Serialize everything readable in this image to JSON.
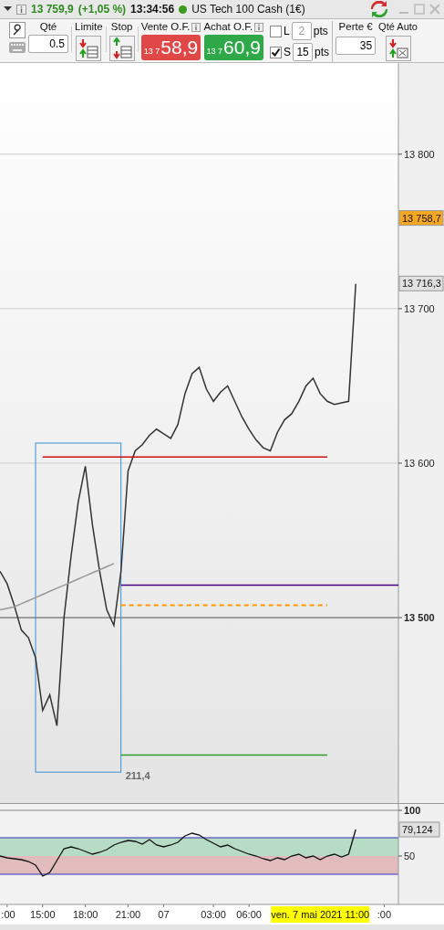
{
  "title_bar": {
    "price": "13 759,9",
    "change": "(+1,05 %)",
    "time": "13:34:56",
    "instrument": "US Tech 100 Cash (1€)"
  },
  "toolbar": {
    "qty": {
      "label": "Qté",
      "value": "0.5"
    },
    "limit": {
      "label": "Limite"
    },
    "stop": {
      "label": "Stop"
    },
    "sell": {
      "label": "Vente O.F.",
      "prefix": "13 7",
      "price": "58,9"
    },
    "buy": {
      "label": "Achat O.F.",
      "prefix": "13 7",
      "price": "60,9"
    },
    "offsets": [
      {
        "label": "L",
        "checked": false,
        "value": "2",
        "disabled": true,
        "unit": "pts"
      },
      {
        "label": "S",
        "checked": true,
        "value": "15",
        "disabled": false,
        "unit": "pts"
      }
    ],
    "loss": {
      "label": "Perte €",
      "value": "35"
    },
    "auto_qty": {
      "label": "Qté Auto"
    }
  },
  "price_chart": {
    "chart_data": {
      "type": "line",
      "grid": true,
      "ylim": [
        13380,
        13859
      ],
      "yticks": [
        {
          "value": 13500,
          "label": "13 500"
        },
        {
          "value": 13600,
          "label": "13 600"
        },
        {
          "value": 13700,
          "label": "13 700"
        },
        {
          "value": 13800,
          "label": "13 800"
        },
        {
          "value": 13758.7,
          "label": "13 758,7"
        },
        {
          "value": 13716.3,
          "label": "13 716,3"
        }
      ],
      "series": [
        {
          "color": "#333333",
          "values": [
            13530,
            13522,
            13508,
            13492,
            13487,
            13474,
            13440,
            13450,
            13430,
            13500,
            13540,
            13575,
            13598,
            13560,
            13530,
            13505,
            13495,
            13530,
            13595,
            13608,
            13612,
            13618,
            13622,
            13619,
            13616,
            13625,
            13645,
            13658,
            13662,
            13648,
            13640,
            13646,
            13650,
            13640,
            13630,
            13622,
            13615,
            13610,
            13608,
            13620,
            13628,
            13632,
            13640,
            13650,
            13655,
            13645,
            13640,
            13638,
            13639,
            13640,
            13716,
            null,
            null,
            null,
            null,
            null,
            null
          ]
        },
        {
          "color": "#999999",
          "values": [
            13505,
            13506,
            13507,
            13509,
            13511,
            13513,
            13515,
            13517,
            13519,
            13521,
            13523,
            13525,
            13527,
            13529,
            13531,
            13533,
            13535,
            null,
            null,
            null,
            null,
            null,
            null,
            null,
            null,
            null,
            null,
            null,
            null,
            null,
            null,
            null,
            null,
            null,
            null,
            null,
            null,
            null,
            null,
            null,
            null,
            null,
            null,
            null,
            null,
            null,
            null,
            null,
            null,
            null,
            null,
            null,
            null,
            null,
            null,
            null,
            null
          ]
        },
        {
          "color": "#d01010",
          "values": [
            null,
            null,
            null,
            null,
            null,
            null,
            13604,
            13604,
            13604,
            13604,
            13604,
            13604,
            13604,
            13604,
            13604,
            13604,
            13604,
            13604,
            13604,
            13604,
            13604,
            13604,
            13604,
            13604,
            13604,
            13604,
            13604,
            13604,
            13604,
            13604,
            13604,
            13604,
            13604,
            13604,
            13604,
            13604,
            13604,
            13604,
            13604,
            13604,
            13604,
            13604,
            13604,
            13604,
            13604,
            13604,
            13604,
            null,
            null,
            null,
            null,
            null,
            null,
            null,
            null,
            null,
            null
          ]
        },
        {
          "color": "#4b0082",
          "values": [
            null,
            null,
            null,
            null,
            null,
            null,
            null,
            null,
            null,
            null,
            null,
            null,
            null,
            null,
            null,
            null,
            null,
            13521,
            13521,
            13521,
            13521,
            13521,
            13521,
            13521,
            13521,
            13521,
            13521,
            13521,
            13521,
            13521,
            13521,
            13521,
            13521,
            13521,
            13521,
            13521,
            13521,
            13521,
            13521,
            13521,
            13521,
            13521,
            13521,
            13521,
            13521,
            13521,
            13521,
            13521,
            13521,
            13521,
            13521,
            13521,
            13521,
            13521,
            13521,
            13521,
            13521
          ]
        },
        {
          "color": "#ff9900",
          "line_style": "dashed",
          "values": [
            null,
            null,
            null,
            null,
            null,
            null,
            null,
            null,
            null,
            null,
            null,
            null,
            null,
            null,
            null,
            null,
            null,
            13508,
            13508,
            13508,
            13508,
            13508,
            13508,
            13508,
            13508,
            13508,
            13508,
            13508,
            13508,
            13508,
            13508,
            13508,
            13508,
            13508,
            13508,
            13508,
            13508,
            13508,
            13508,
            13508,
            13508,
            13508,
            13508,
            13508,
            13508,
            13508,
            13508,
            null,
            null,
            null,
            null,
            null,
            null,
            null,
            null,
            null,
            null
          ]
        },
        {
          "color": "#2e9e2e",
          "values": [
            null,
            null,
            null,
            null,
            null,
            null,
            null,
            null,
            null,
            null,
            null,
            null,
            null,
            null,
            null,
            null,
            null,
            13411,
            13411,
            13411,
            13411,
            13411,
            13411,
            13411,
            13411,
            13411,
            13411,
            13411,
            13411,
            13411,
            13411,
            13411,
            13411,
            13411,
            13411,
            13411,
            13411,
            13411,
            13411,
            13411,
            13411,
            13411,
            13411,
            13411,
            13411,
            13411,
            13411,
            null,
            null,
            null,
            null,
            null,
            null,
            null,
            null,
            null,
            null
          ]
        }
      ],
      "ref_lines": [
        {
          "axis": "y",
          "value": 13500,
          "color": "#777777"
        }
      ],
      "annotations": [
        "211,4"
      ]
    }
  },
  "oscillator": {
    "chart_data": {
      "type": "line",
      "ylim": [
        -3,
        107
      ],
      "categories": [
        null,
        ":00",
        null,
        null,
        null,
        null,
        "15:00",
        null,
        null,
        null,
        null,
        null,
        "18:00",
        null,
        null,
        null,
        null,
        null,
        "21:00",
        null,
        null,
        null,
        null,
        "07",
        null,
        null,
        null,
        null,
        null,
        null,
        "03:00",
        null,
        null,
        null,
        null,
        "06:00",
        null,
        null,
        null,
        null,
        null,
        null,
        null,
        null,
        null,
        null,
        null,
        null,
        null,
        null,
        null,
        null,
        null,
        null,
        ":00",
        null,
        null
      ],
      "yticks": [
        {
          "value": 100,
          "label": "100"
        },
        {
          "value": 50,
          "label": "50"
        }
      ],
      "ref_lines": [
        {
          "axis": "y",
          "value": 70,
          "color": "#3030c0"
        },
        {
          "axis": "y",
          "value": 30,
          "color": "#3030c0"
        }
      ],
      "bands": [
        {
          "axis": "y",
          "from": 50,
          "to": 70,
          "color": "#b7dcc5"
        },
        {
          "axis": "y",
          "from": 30,
          "to": 50,
          "color": "#e2bcbc"
        }
      ],
      "series": [
        {
          "color": "#111111",
          "values": [
            50,
            48,
            47,
            46,
            44,
            40,
            28,
            32,
            45,
            58,
            60,
            58,
            55,
            52,
            54,
            57,
            62,
            65,
            67,
            66,
            63,
            68,
            62,
            60,
            62,
            65,
            72,
            75,
            73,
            68,
            64,
            60,
            62,
            58,
            55,
            52,
            50,
            47,
            45,
            48,
            46,
            50,
            52,
            48,
            50,
            46,
            50,
            52,
            49,
            52,
            79,
            null,
            null,
            null,
            null,
            null,
            null
          ]
        }
      ]
    }
  },
  "last_value": "79,124",
  "time_axis": {
    "cursor_label": "ven. 7 mai 2021 11:00"
  }
}
